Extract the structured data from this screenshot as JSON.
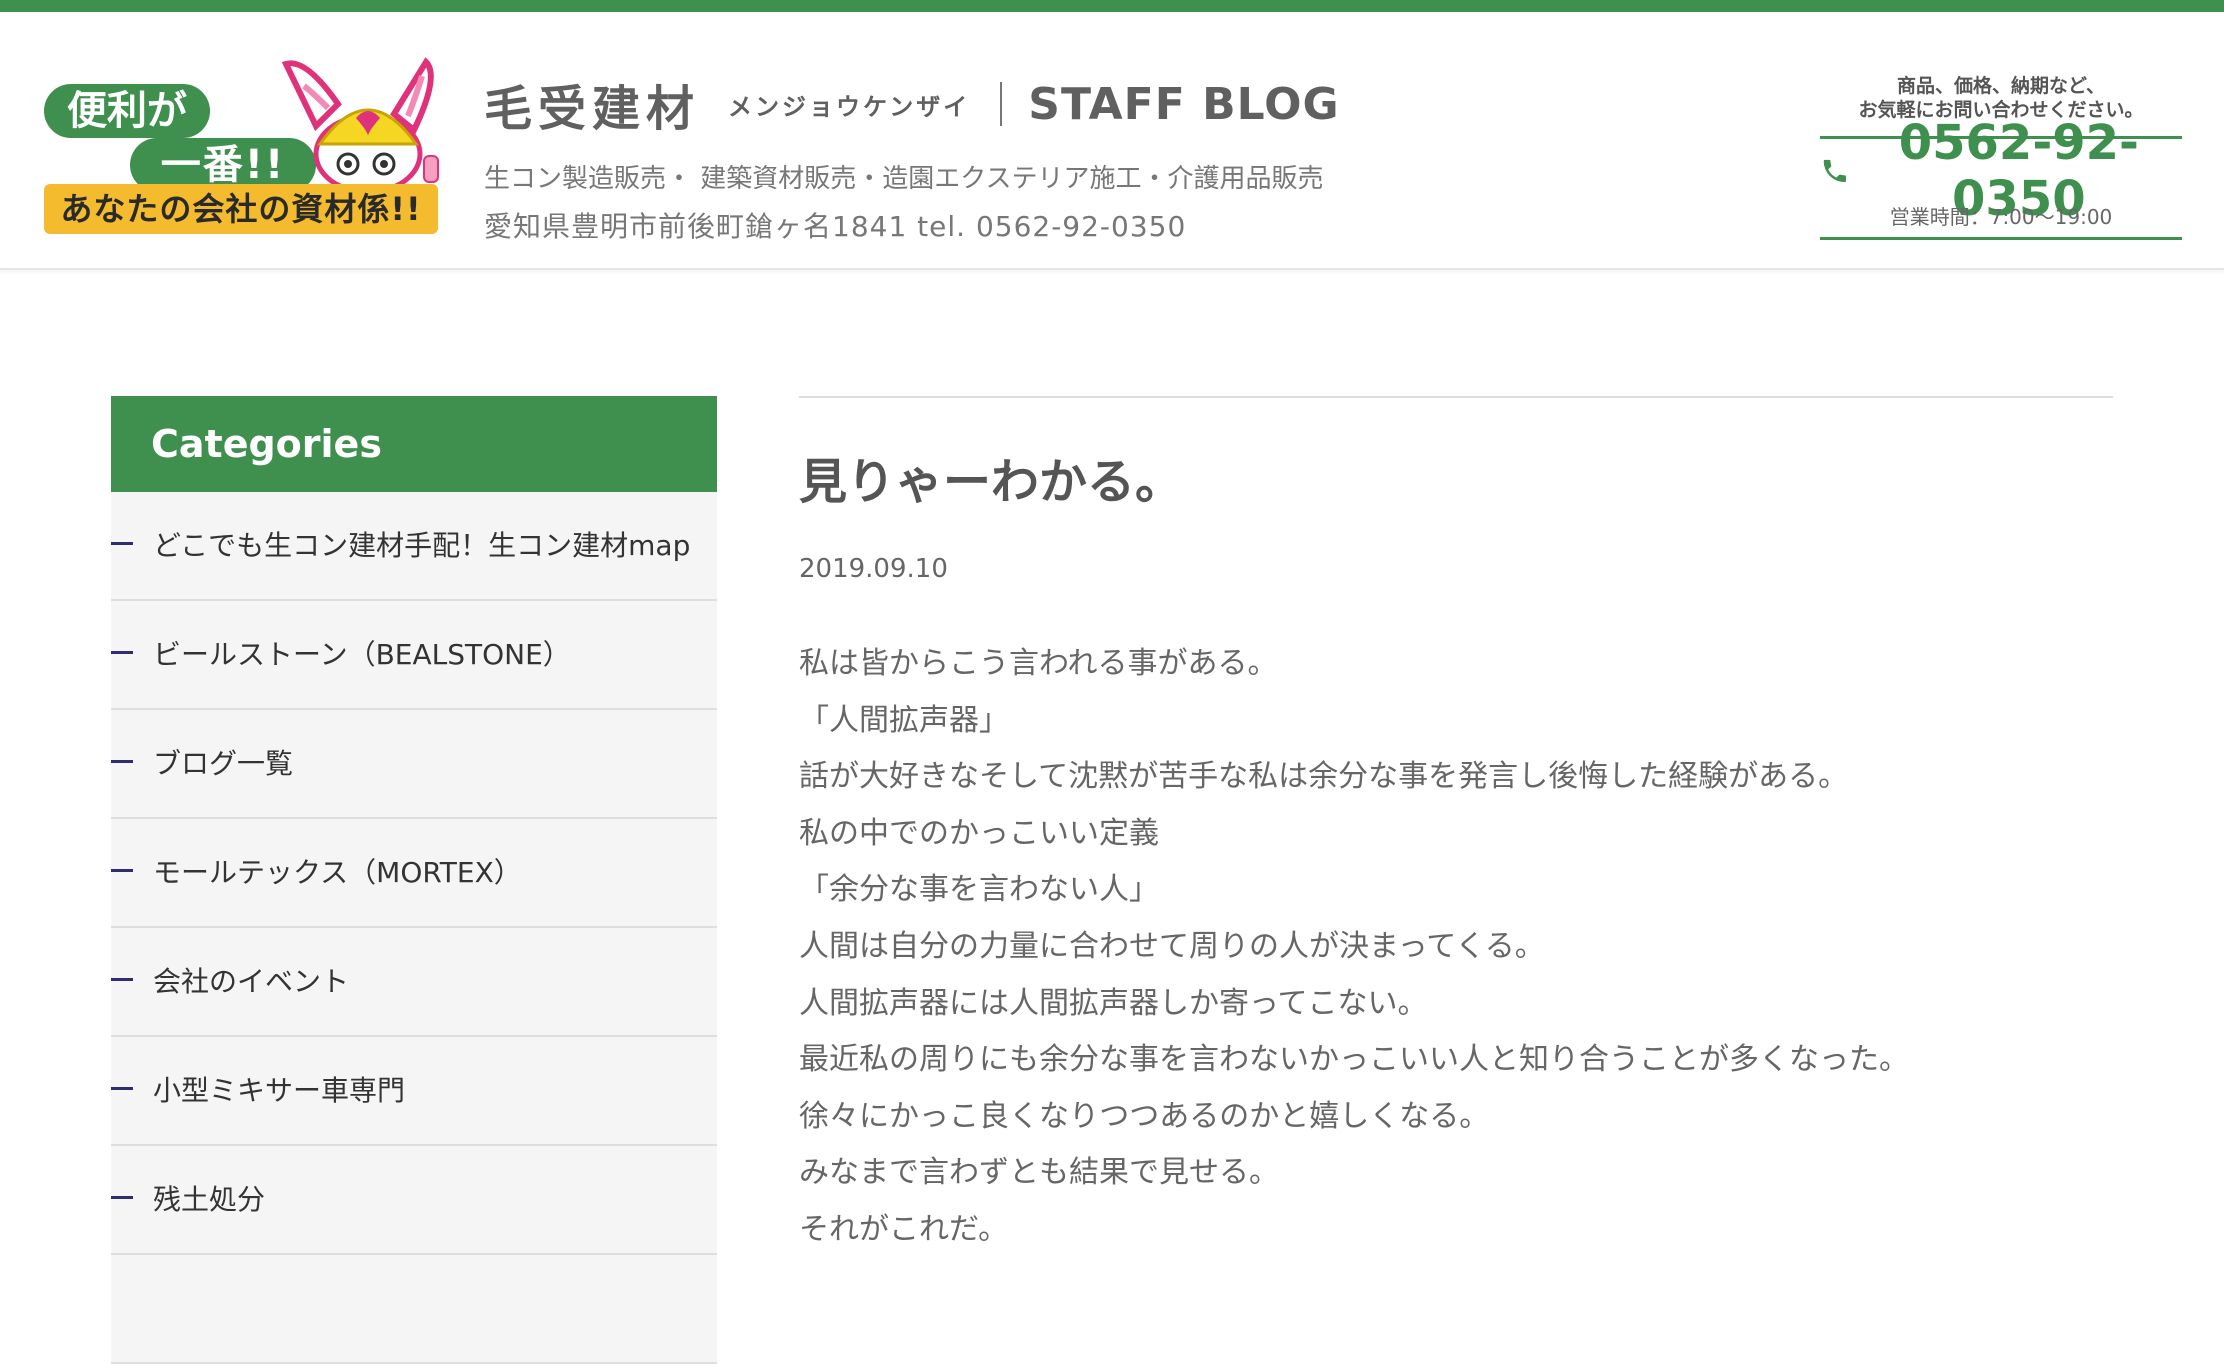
{
  "header": {
    "logo": {
      "line1": "便利が",
      "line2": "一番!!",
      "banner": "あなたの会社の資材係!!"
    },
    "brand_name": "毛受建材",
    "brand_kana": "メンジョウケンザイ",
    "blog_title": "STAFF BLOG",
    "services": "生コン製造販売・ 建築資材販売・造園エクステリア施工・介護用品販売",
    "address": "愛知県豊明市前後町鎗ヶ名1841 tel. 0562-92-0350",
    "contact_note_1": "商品、価格、納期など、",
    "contact_note_2": "お気軽にお問い合わせください。",
    "phone": "0562-92-0350",
    "hours": "営業時間：7:00〜19:00"
  },
  "sidebar": {
    "heading": "Categories",
    "items": [
      {
        "label": "どこでも生コン建材手配！生コン建材map"
      },
      {
        "label": "ビールストーン（BEALSTONE）"
      },
      {
        "label": "ブログ一覧"
      },
      {
        "label": "モールテックス（MORTEX）"
      },
      {
        "label": "会社のイベント"
      },
      {
        "label": "小型ミキサー車専門"
      },
      {
        "label": "残土処分"
      }
    ]
  },
  "article": {
    "title": "見りゃーわかる。",
    "date": "2019.09.10",
    "lines": [
      "私は皆からこう言われる事がある。",
      "「人間拡声器」",
      "話が大好きなそして沈黙が苦手な私は余分な事を発言し後悔した経験がある。",
      "私の中でのかっこいい定義",
      "「余分な事を言わない人」",
      "人間は自分の力量に合わせて周りの人が決まってくる。",
      "人間拡声器には人間拡声器しか寄ってこない。",
      "最近私の周りにも余分な事を言わないかっこいい人と知り合うことが多くなった。",
      "徐々にかっこ良くなりつつあるのかと嬉しくなる。",
      "みなまで言わずとも結果で見せる。",
      "それがこれだ。"
    ]
  },
  "colors": {
    "accent_green": "#3f8f4f",
    "logo_yellow": "#f4bb2e",
    "sidebar_bg": "#f5f5f5",
    "dash_navy": "#2e2d6e"
  },
  "icons": {
    "phone": "phone-icon",
    "mascot": "rabbit-mascot-icon"
  }
}
